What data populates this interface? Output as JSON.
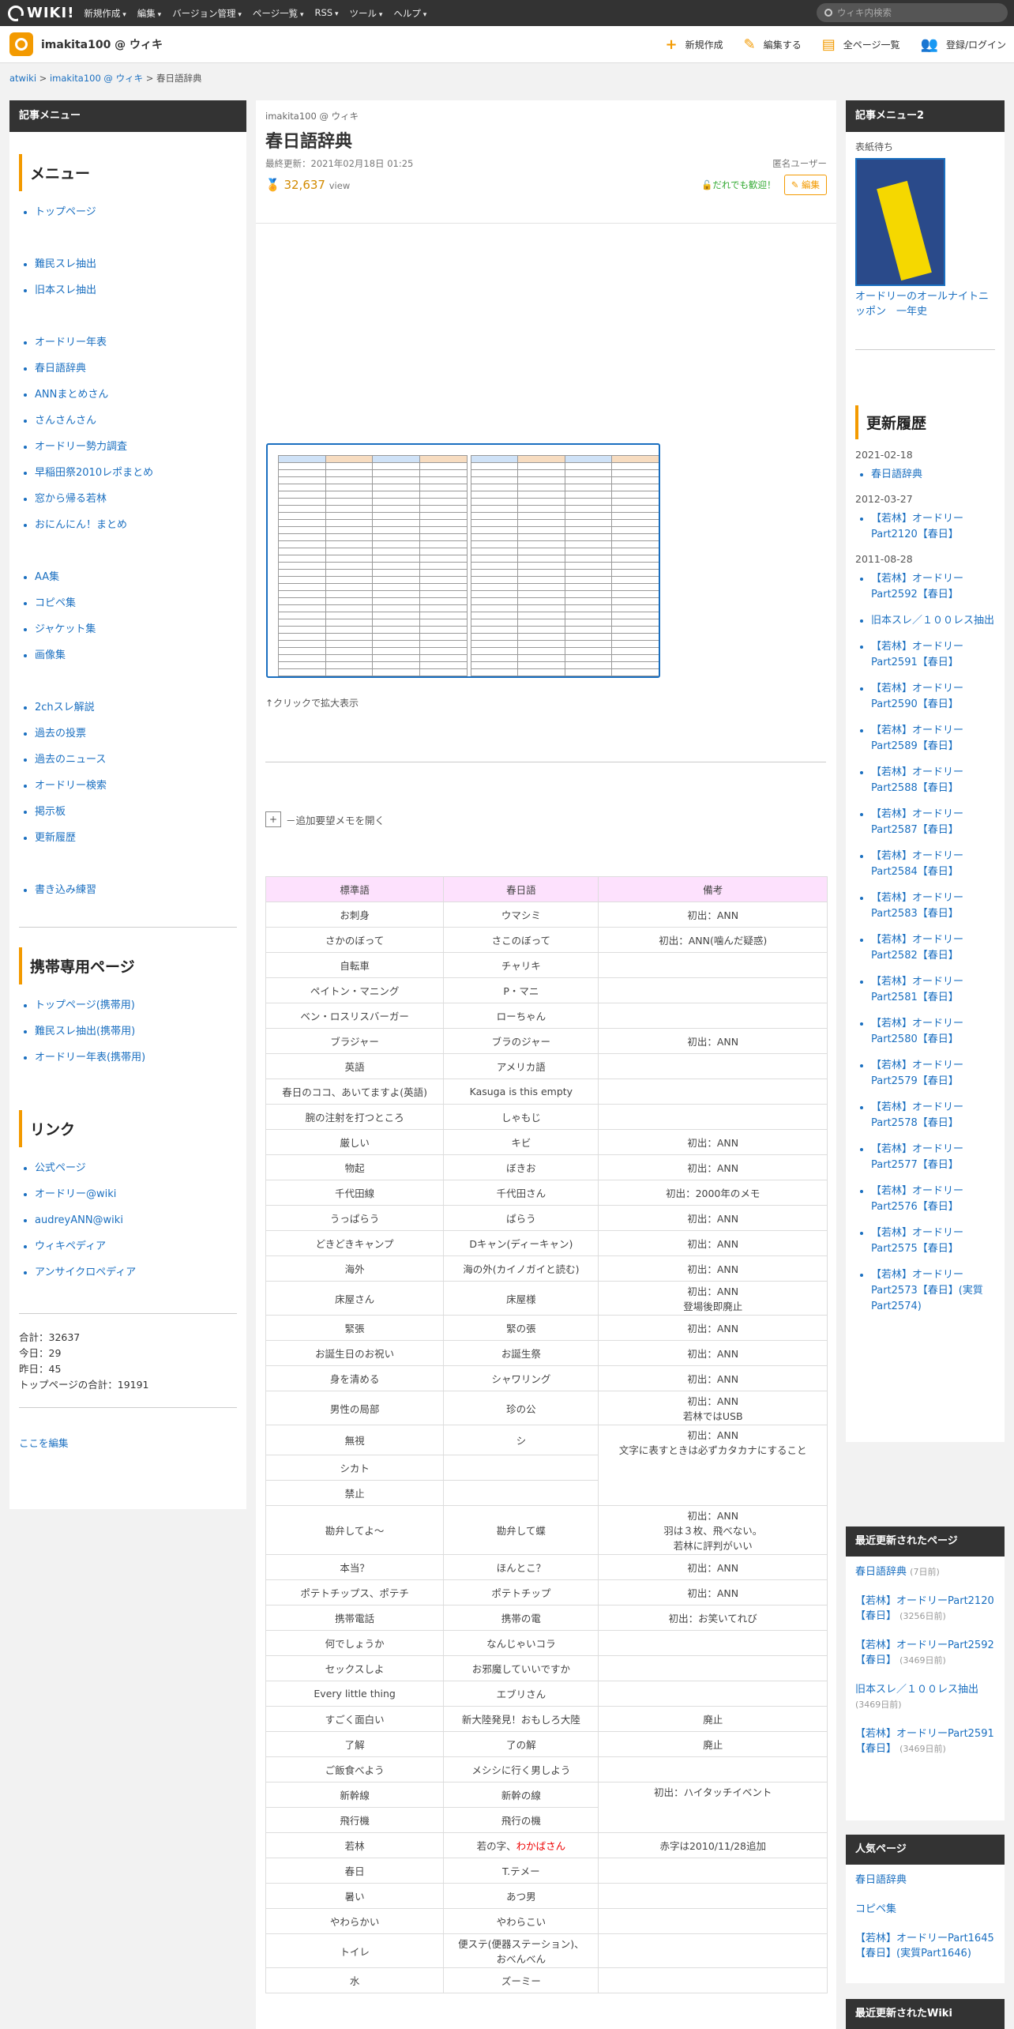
{
  "topbar": {
    "logo": "WIKI!",
    "nav": [
      "新規作成",
      "編集",
      "バージョン管理",
      "ページ一覧",
      "RSS",
      "ツール",
      "ヘルプ"
    ],
    "search_placeholder": "ウィキ内検索"
  },
  "header": {
    "wiki_name": "imakita100 @ ウィキ",
    "actions": [
      "新規作成",
      "編集する",
      "全ページ一覧",
      "登録/ログイン"
    ]
  },
  "breadcrumb": [
    "atwiki",
    "imakita100 @ ウィキ",
    "春日語辞典"
  ],
  "left": {
    "head": "記事メニュー",
    "menu_title": "メニュー",
    "group1": [
      "トップページ"
    ],
    "group2": [
      "難民スレ抽出",
      "旧本スレ抽出"
    ],
    "group3": [
      "オードリー年表",
      "春日語辞典",
      "ANNまとめさん",
      "さんさんさん",
      "オードリー勢力調査",
      "早稲田祭2010レポまとめ",
      "窓から帰る若林",
      "おにんにん！まとめ"
    ],
    "group4": [
      "AA集",
      "コピペ集",
      "ジャケット集",
      "画像集"
    ],
    "group5": [
      "2chスレ解説",
      "過去の投票",
      "過去のニュース",
      "オードリー検索",
      "掲示板",
      "更新履歴"
    ],
    "group6": [
      "書き込み練習"
    ],
    "mobile_title": "携帯専用ページ",
    "mobile": [
      "トップページ(携帯用)",
      "難民スレ抽出(携帯用)",
      "オードリー年表(携帯用)"
    ],
    "links_title": "リンク",
    "links": [
      "公式ページ",
      "オードリー@wiki",
      "audreyANN@wiki",
      "ウィキペディア",
      "アンサイクロペディア"
    ],
    "stats": [
      "合計：32637",
      "今日：29",
      "昨日：45",
      "トップページの合計：19191"
    ],
    "edit_here": "ここを編集"
  },
  "page": {
    "wiki": "imakita100 @ ウィキ",
    "title": "春日語辞典",
    "updated": "最終更新：2021年02月18日 01:25",
    "user": "匿名ユーザー",
    "views": "32,637",
    "views_unit": "view",
    "welcome": "だれでも歓迎！",
    "edit": "編集",
    "caption": "↑クリックで拡大表示",
    "memo": "－追加要望メモを開く",
    "table_headers": [
      "標準語",
      "春日語",
      "備考"
    ],
    "rows": [
      [
        "お刺身",
        "ウマシミ",
        "初出：ANN"
      ],
      [
        "さかのぼって",
        "さこのぼって",
        "初出：ANN(噛んだ疑惑)"
      ],
      [
        "自転車",
        "チャリキ",
        ""
      ],
      [
        "ペイトン・マニング",
        "P・マニ",
        ""
      ],
      [
        "ベン・ロスリスバーガー",
        "ローちゃん",
        ""
      ],
      [
        "ブラジャー",
        "ブラのジャー",
        "初出：ANN"
      ],
      [
        "英語",
        "アメリカ語",
        ""
      ],
      [
        "春日のココ、あいてますよ(英語)",
        "Kasuga is this empty",
        ""
      ],
      [
        "腕の注射を打つところ",
        "しゃもじ",
        ""
      ],
      [
        "厳しい",
        "キビ",
        "初出：ANN"
      ],
      [
        "物起",
        "ぼきお",
        "初出：ANN"
      ],
      [
        "千代田線",
        "千代田さん",
        "初出：2000年のメモ"
      ],
      [
        "うっぱらう",
        "ぱらう",
        "初出：ANN"
      ],
      [
        "どきどきキャンプ",
        "Dキャン(ディーキャン)",
        "初出：ANN"
      ],
      [
        "海外",
        "海の外(カイノガイと読む)",
        "初出：ANN"
      ],
      [
        "床屋さん",
        "床屋様",
        "初出：ANN\n登場後即廃止"
      ],
      [
        "緊張",
        "緊の張",
        "初出：ANN"
      ],
      [
        "お誕生日のお祝い",
        "お誕生祭",
        "初出：ANN"
      ],
      [
        "身を清める",
        "シャワリング",
        "初出：ANN"
      ],
      [
        "男性の局部",
        "珍の公",
        "初出：ANN\n若林ではUSB"
      ],
      [
        "無視",
        "シ",
        "初出：ANN\n文字に表すときは必ずカタカナにすること"
      ],
      [
        "シカト",
        "",
        ""
      ],
      [
        "禁止",
        "",
        ""
      ],
      [
        "勘弁してよ～",
        "勘弁して蝶",
        "初出：ANN\n羽は３枚、飛べない。\n若林に評判がいい"
      ],
      [
        "本当？",
        "ほんとこ？",
        "初出：ANN"
      ],
      [
        "ポテトチップス、ポテチ",
        "ポテトチップ",
        "初出：ANN"
      ],
      [
        "携帯電話",
        "携帯の電",
        "初出：お笑いてれび"
      ],
      [
        "何でしょうか",
        "なんじゃいコラ",
        ""
      ],
      [
        "セックスしよ",
        "お邪魔していいですか",
        ""
      ],
      [
        "Every little thing",
        "エブリさん",
        ""
      ],
      [
        "すごく面白い",
        "新大陸発見！おもしろ大陸",
        "廃止"
      ],
      [
        "了解",
        "了の解",
        "廃止"
      ],
      [
        "ご飯食べよう",
        "メシシに行く男しよう",
        ""
      ],
      [
        "新幹線",
        "新幹の線",
        "初出：ハイタッチイベント"
      ],
      [
        "飛行機",
        "飛行の機",
        ""
      ],
      [
        "若林",
        "若の字、",
        "赤字は2010/11/28追加"
      ],
      [
        "春日",
        "T.テメー",
        ""
      ],
      [
        "暑い",
        "あつ男",
        ""
      ],
      [
        "やわらかい",
        "やわらこい",
        ""
      ],
      [
        "トイレ",
        "便ステ(便器ステーション)、\nおべんべん",
        ""
      ],
      [
        "水",
        "ズーミー",
        ""
      ]
    ],
    "wakaba_red": "わかばさん"
  },
  "right": {
    "head": "記事メニュー2",
    "book_label": "表紙待ち",
    "book_title": "オードリーのオールナイトニッポン　一年史",
    "history_title": "更新履歴",
    "history": [
      {
        "date": "2021-02-18",
        "items": [
          "春日語辞典"
        ]
      },
      {
        "date": "2012-03-27",
        "items": [
          "【若林】オードリーPart2120【春日】"
        ]
      },
      {
        "date": "2011-08-28",
        "items": [
          "【若林】オードリーPart2592【春日】",
          "旧本スレ／１００レス抽出",
          "【若林】オードリーPart2591【春日】",
          "【若林】オードリーPart2590【春日】",
          "【若林】オードリーPart2589【春日】",
          "【若林】オードリーPart2588【春日】",
          "【若林】オードリーPart2587【春日】",
          "【若林】オードリーPart2584【春日】",
          "【若林】オードリーPart2583【春日】",
          "【若林】オードリーPart2582【春日】",
          "【若林】オードリーPart2581【春日】",
          "【若林】オードリーPart2580【春日】",
          "【若林】オードリーPart2579【春日】",
          "【若林】オードリーPart2578【春日】",
          "【若林】オードリーPart2577【春日】",
          "【若林】オードリーPart2576【春日】",
          "【若林】オードリーPart2575【春日】",
          "【若林】オードリーPart2573【春日】(実質Part2574)"
        ]
      }
    ],
    "recent_head": "最近更新されたページ",
    "recent": [
      {
        "title": "春日語辞典",
        "age": "(7日前)"
      },
      {
        "title": "【若林】オードリーPart2120【春日】",
        "age": "(3256日前)"
      },
      {
        "title": "【若林】オードリーPart2592【春日】",
        "age": "(3469日前)"
      },
      {
        "title": "旧本スレ／１００レス抽出",
        "age": "(3469日前)"
      },
      {
        "title": "【若林】オードリーPart2591【春日】",
        "age": "(3469日前)"
      }
    ],
    "popular_head": "人気ページ",
    "popular": [
      "春日語辞典",
      "コピペ集",
      "【若林】オードリーPart1645【春日】(実質Part1646)"
    ],
    "recent_wiki_head": "最近更新されたWiki"
  }
}
